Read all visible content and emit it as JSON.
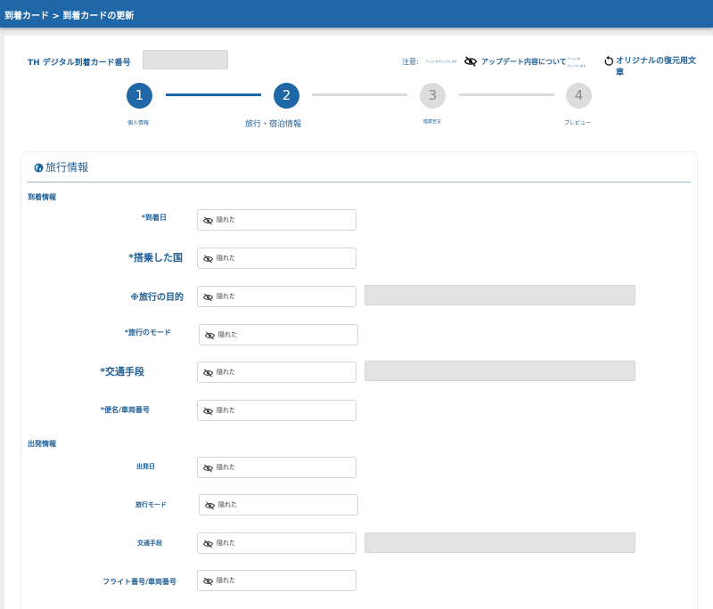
{
  "breadcrumb": "到着カード > 到着カードの更新",
  "header": {
    "card_number_label": "TH デジタル到着カード番号",
    "note_label": "注意:",
    "note_tiny_1": "アイコンをクリックします",
    "update_link": "アップデート内容について",
    "note_tiny_2": "アイコンを",
    "note_tiny_3": "クリックします",
    "restore_link": "オリジナルの復元用文章"
  },
  "stepper": {
    "steps": [
      {
        "number": "1",
        "label": "個人情報"
      },
      {
        "number": "2",
        "label": "旅行・宿泊情報"
      },
      {
        "number": "3",
        "label": "健康宣言"
      },
      {
        "number": "4",
        "label": "プレビュー"
      }
    ],
    "current": 2
  },
  "card": {
    "title": "旅行情報",
    "arrival_section": "到着情報",
    "departure_section": "出発情報",
    "hidden_text": "隠れた",
    "arrival_fields": [
      {
        "label": "*到着日"
      },
      {
        "label": "*搭乗した国"
      },
      {
        "label": "※旅行の目的"
      },
      {
        "label": "*旅行のモード"
      },
      {
        "label": "*交通手段"
      },
      {
        "label": "*便名/車両番号"
      }
    ],
    "departure_fields": [
      {
        "label": "出発日"
      },
      {
        "label": "旅行モード"
      },
      {
        "label": "交通手段"
      },
      {
        "label": "フライト番号/車両番号"
      }
    ]
  },
  "colors": {
    "brand": "#1f67a6",
    "text": "#1f5f96",
    "inactive_step": "#dcdcdc"
  },
  "icons": [
    "eye-off-icon",
    "restore-icon",
    "globe-icon"
  ]
}
